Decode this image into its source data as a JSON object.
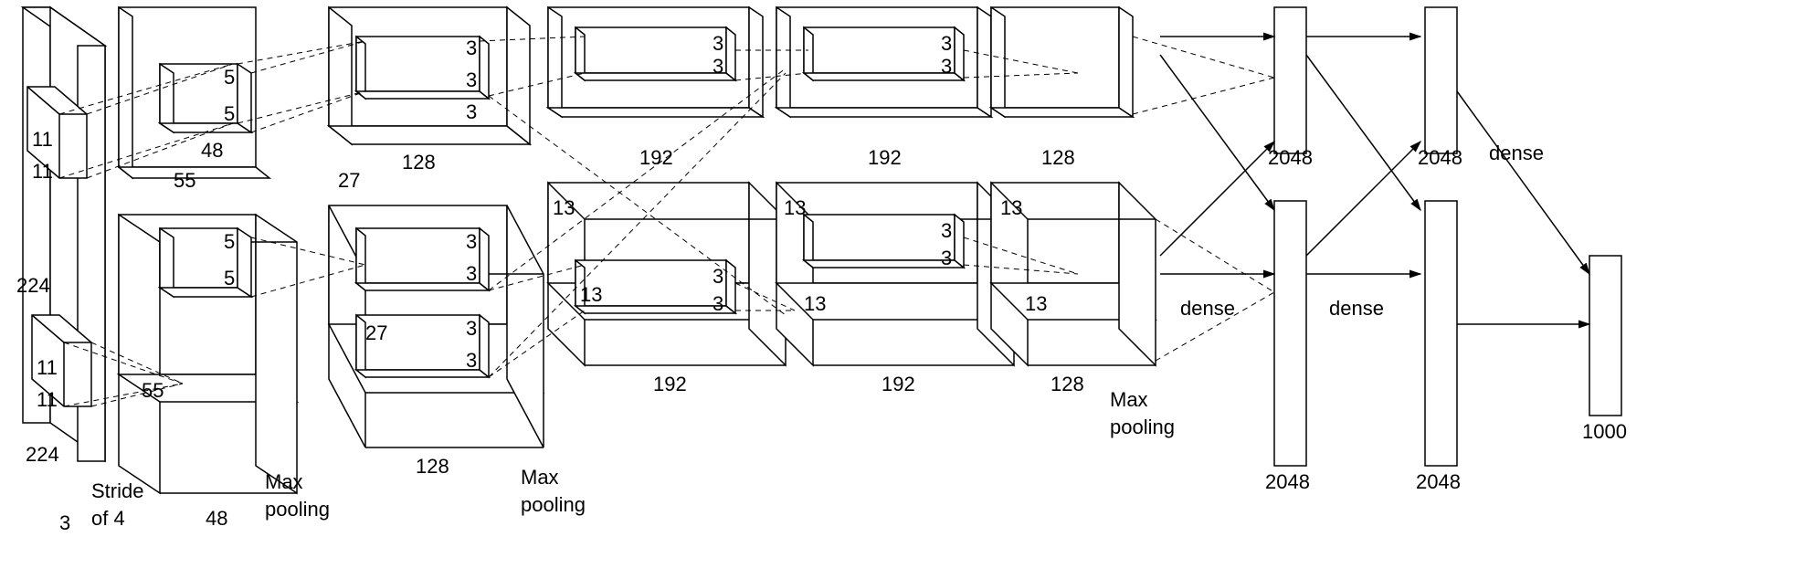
{
  "diagram_type": "CNN architecture (AlexNet-style)",
  "input": {
    "height": "224",
    "width": "224",
    "channels": "3",
    "stride_label": "Stride",
    "stride_of_label": "of 4",
    "filter_top": "11",
    "filter_top2": "11",
    "filter_bot": "11",
    "filter_bot2": "11"
  },
  "conv1": {
    "size": "55",
    "size2": "55",
    "depth": "48",
    "depth2": "48",
    "filter_top": "5",
    "filter_top2": "5",
    "filter_bot": "5",
    "filter_bot2": "5",
    "stage_label": "Max",
    "stage_label2": "pooling"
  },
  "conv2": {
    "size_top": "27",
    "size_bot": "27",
    "depth_top": "128",
    "depth_bot": "128",
    "filter_a": "3",
    "filter_b": "3",
    "filter_c": "3",
    "filter_d": "3",
    "filter_e": "3",
    "filter_f": "3",
    "stage_label": "Max",
    "stage_label2": "pooling"
  },
  "conv3": {
    "size_top": "13",
    "size_bot": "13",
    "depth_top": "192",
    "depth_bot": "192",
    "filter_a": "3",
    "filter_b": "3",
    "filter_c": "3",
    "filter_d": "3"
  },
  "conv4": {
    "size_top": "13",
    "size_bot": "13",
    "depth_top": "192",
    "depth_bot": "192",
    "filter_a": "3",
    "filter_b": "3",
    "filter_c": "3",
    "filter_d": "3"
  },
  "conv5": {
    "size_top": "13",
    "size_bot": "13",
    "depth_top": "128",
    "depth_bot": "128",
    "stage_label": "Max",
    "stage_label2": "pooling"
  },
  "fc": {
    "fc6_top": "2048",
    "fc6_bot": "2048",
    "fc7_top": "2048",
    "fc7_bot": "2048",
    "dense1": "dense",
    "dense2": "dense",
    "dense3": "dense",
    "output": "1000"
  }
}
